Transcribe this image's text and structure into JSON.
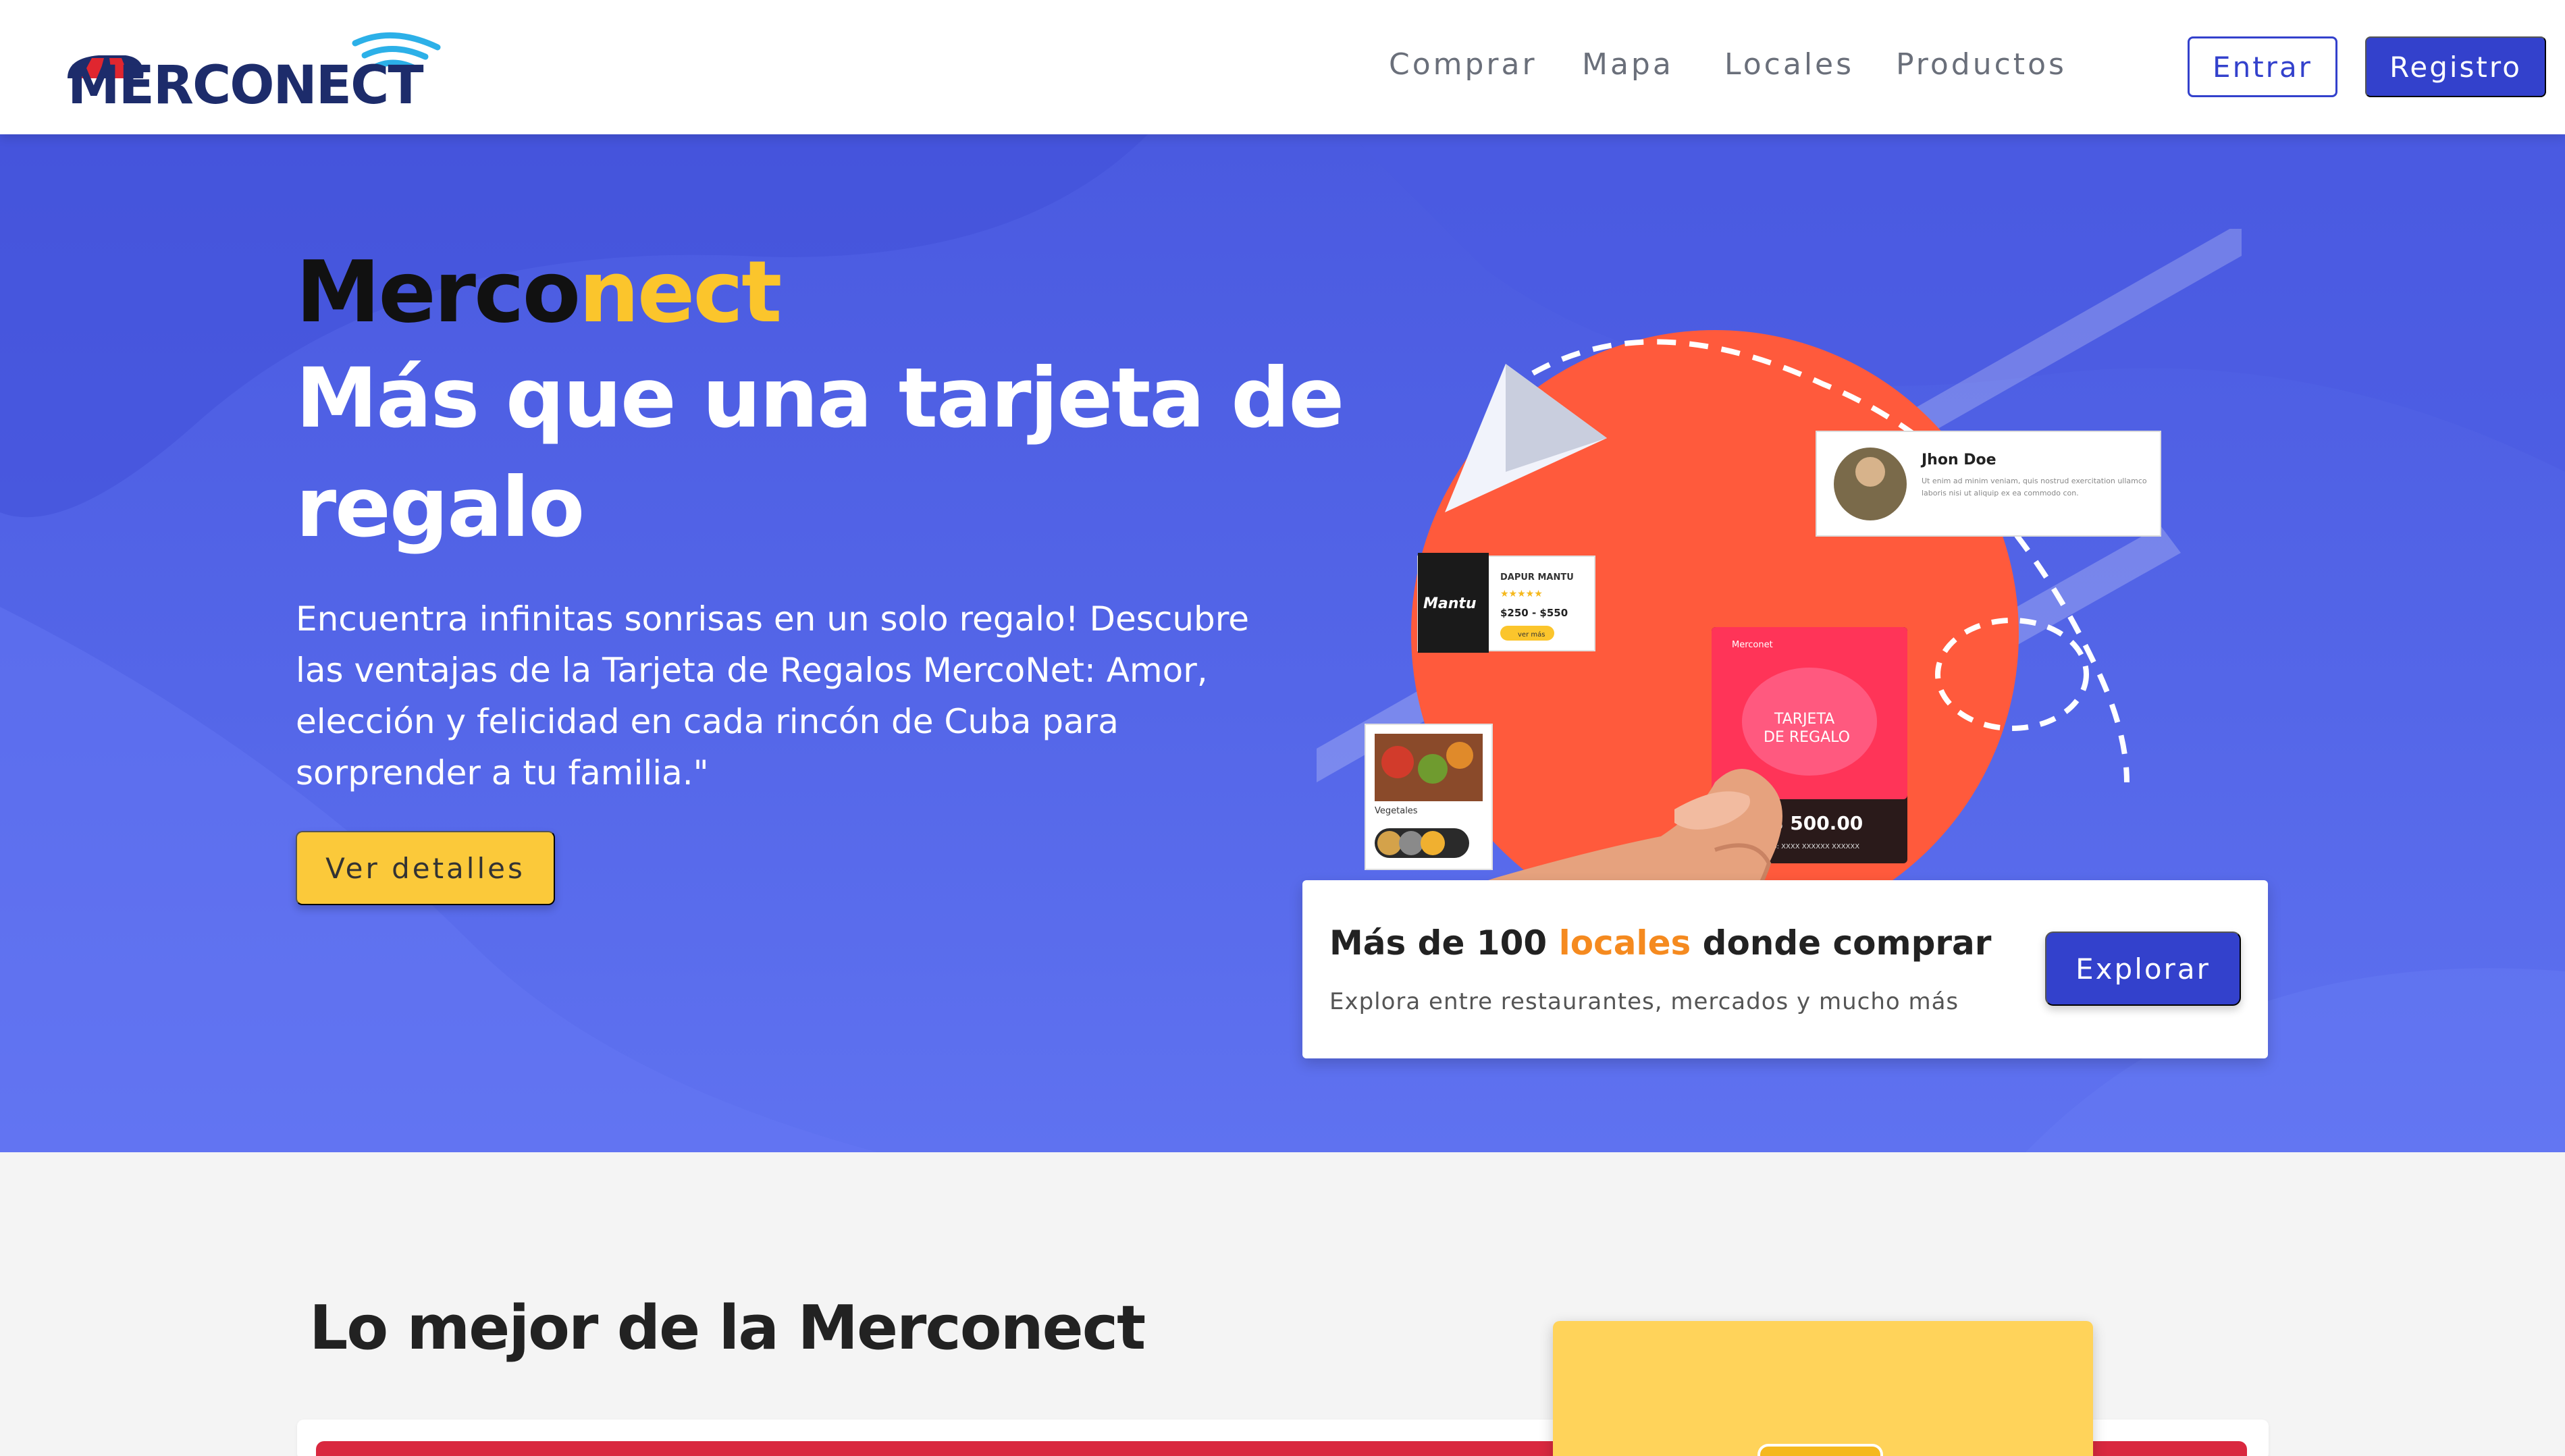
{
  "navbar": {
    "logo_text": "MERCONECT",
    "links": [
      "Comprar",
      "Mapa",
      "Locales",
      "Productos"
    ],
    "login_label": "Entrar",
    "register_label": "Registro"
  },
  "hero": {
    "brand_part1": "Merco",
    "brand_part2": "nect",
    "title": "Más que una tarjeta de regalo",
    "description": "Encuentra infinitas sonrisas en un solo regalo! Descubre las ventajas de la Tarjeta de Regalos MercoNet: Amor, elección y felicidad en cada rincón de Cuba para sorprender a tu familia.\"",
    "details_button": "Ver detalles"
  },
  "illustration": {
    "review_name": "Jhon Doe",
    "review_text": "Ut enim ad minim veniam, quis nostrud exercitation ullamco laboris nisi ut aliquip ex ea commodo con.",
    "store_name": "DAPUR MANTU",
    "store_logo": "Mantu",
    "store_price": "$250 - $550",
    "store_button": "ver más",
    "category": "Vegetales",
    "card_brand": "Merconet",
    "card_title": "TARJETA DE REGALO",
    "card_amount": "$ 500.00",
    "card_code": "digo: XXXX XXXXXX XXXXXX"
  },
  "promo": {
    "title_pre": "Más de 100 ",
    "title_accent": "locales",
    "title_post": " donde comprar",
    "subtitle": "Explora entre restaurantes, mercados y mucho más",
    "button": "Explorar"
  },
  "section": {
    "title": "Lo mejor de la Merconect"
  },
  "colors": {
    "primary": "#3341cc",
    "hero_bg": "#5466e8",
    "accent_yellow": "#fbc52c",
    "accent_orange": "#f58a1f",
    "red": "#d9283f"
  }
}
